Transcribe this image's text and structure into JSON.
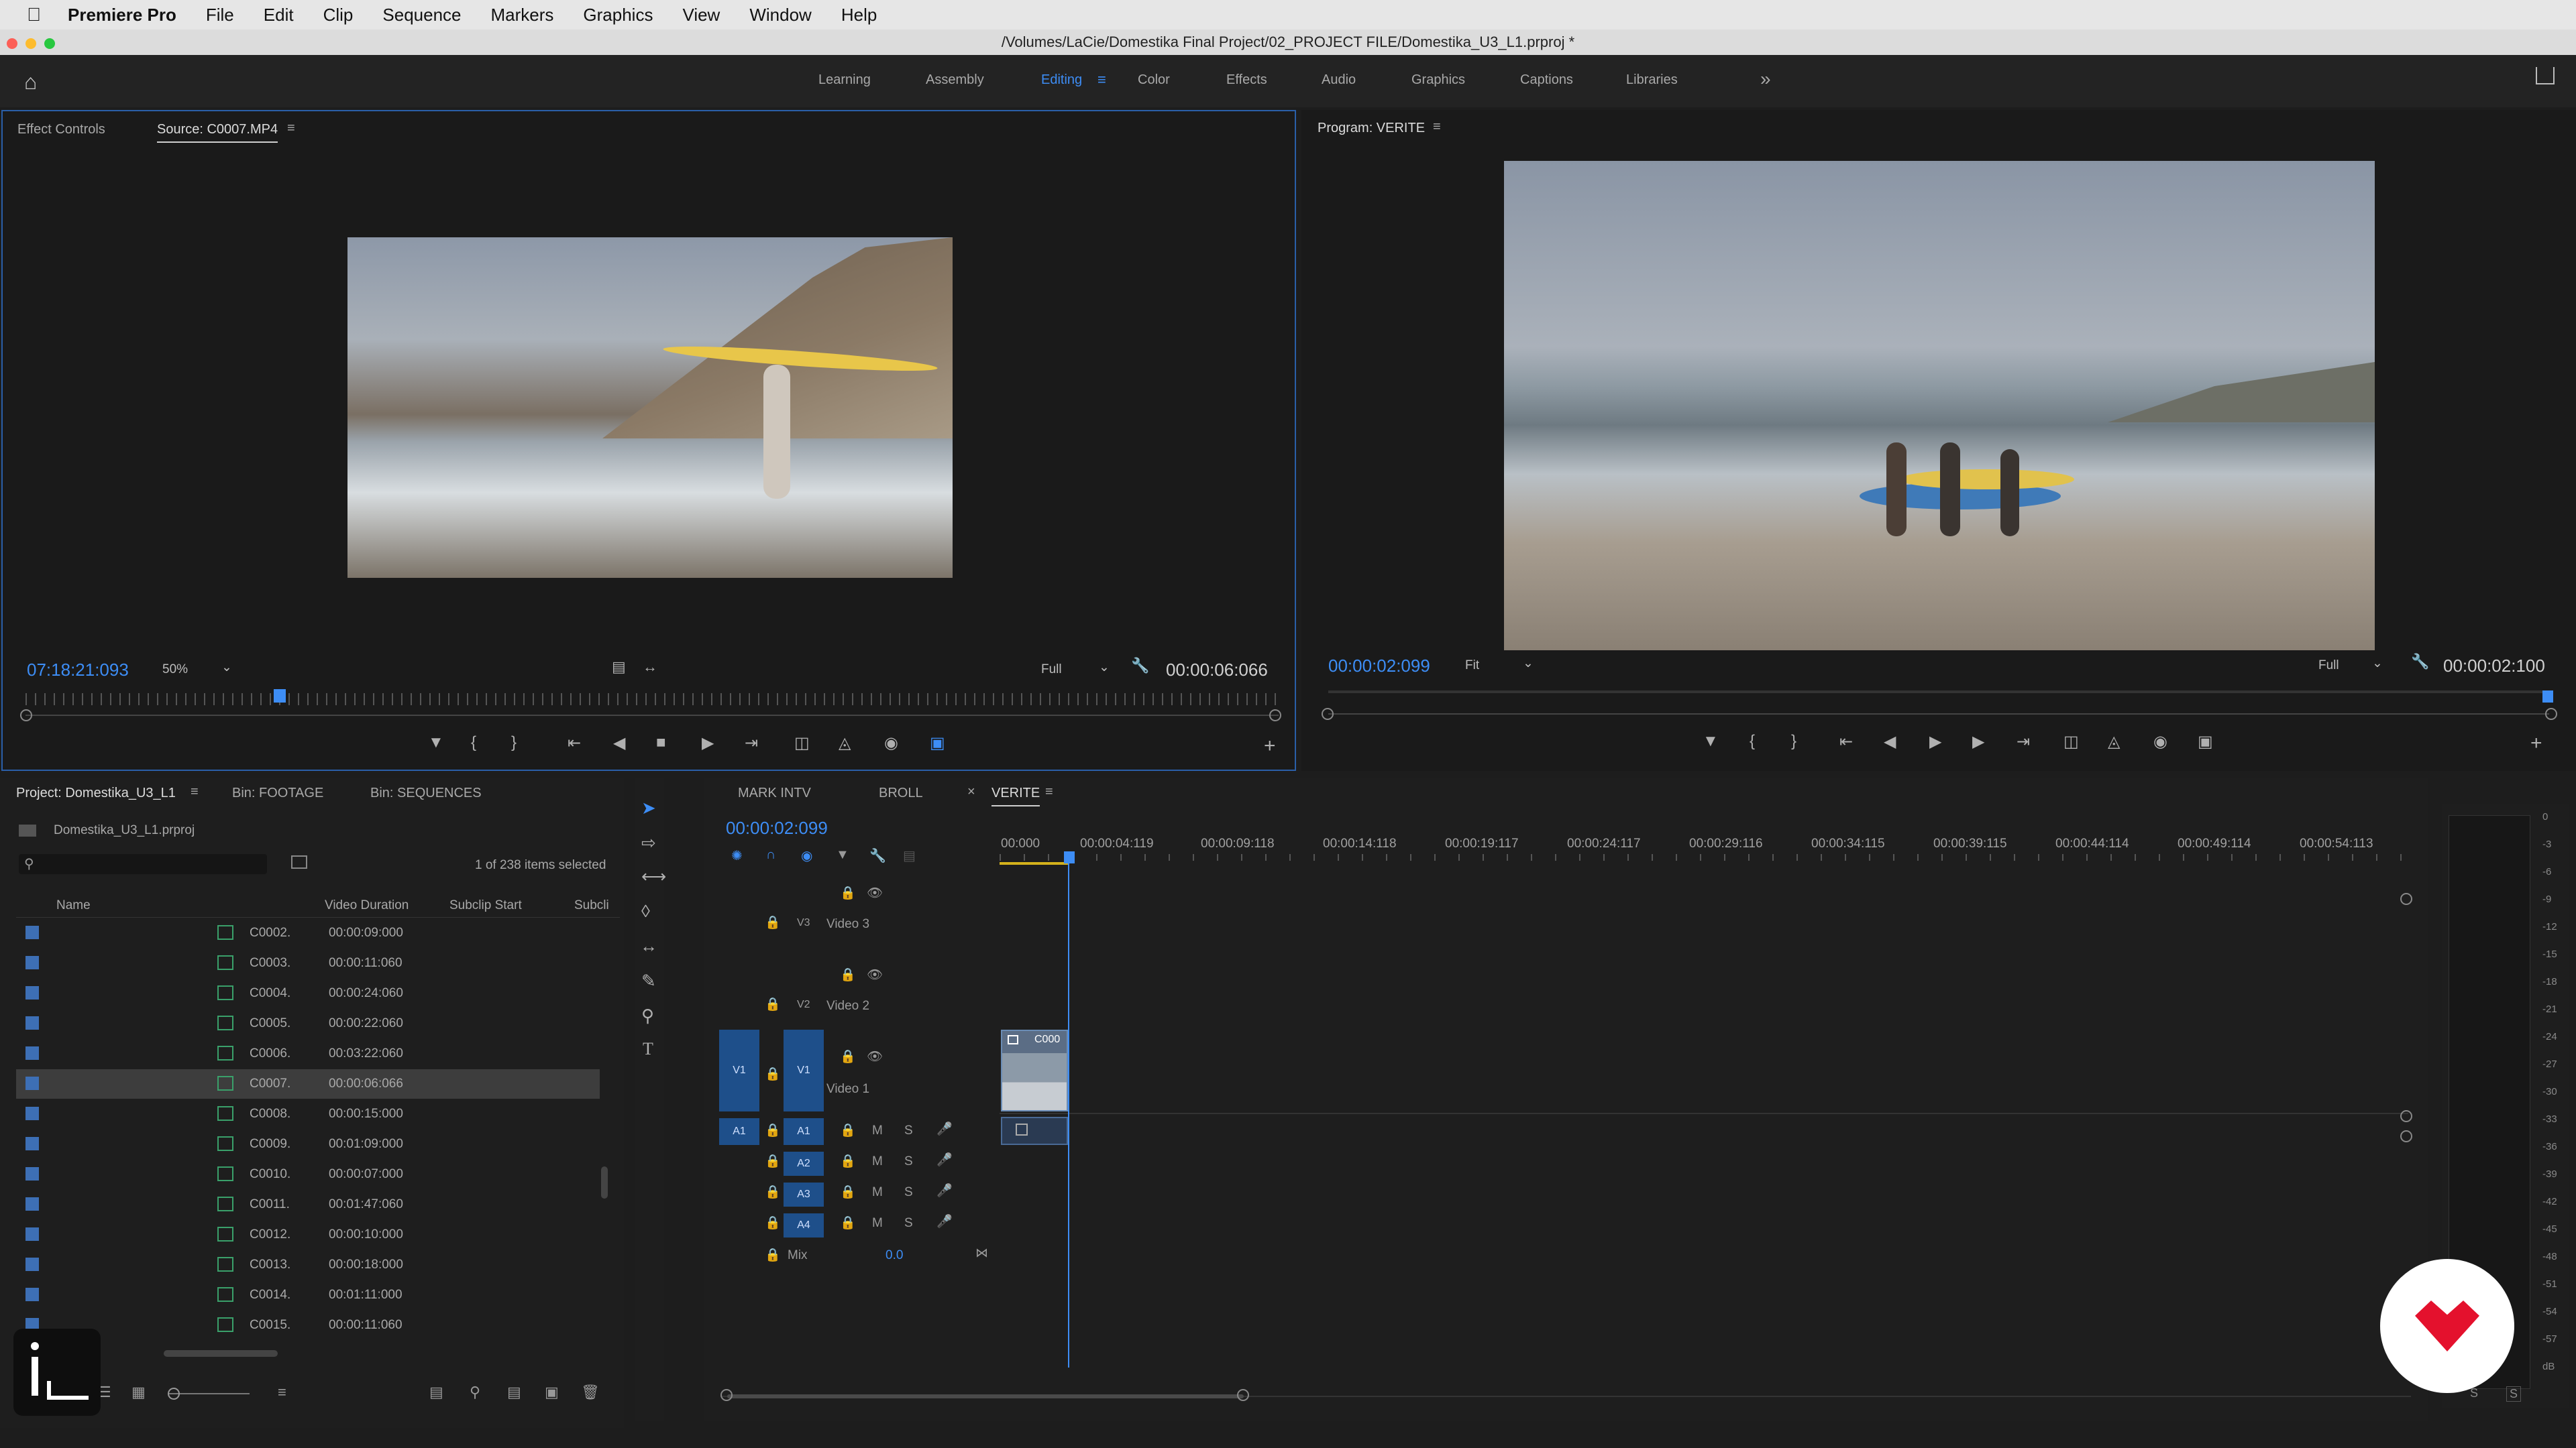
{
  "menubar": {
    "app": "Premiere Pro",
    "items": [
      "File",
      "Edit",
      "Clip",
      "Sequence",
      "Markers",
      "Graphics",
      "View",
      "Window",
      "Help"
    ]
  },
  "title": "/Volumes/LaCie/Domestika Final Project/02_PROJECT FILE/Domestika_U3_L1.prproj *",
  "workspaces": [
    {
      "label": "Learning"
    },
    {
      "label": "Assembly"
    },
    {
      "label": "Editing"
    },
    {
      "label": "Color"
    },
    {
      "label": "Effects"
    },
    {
      "label": "Audio"
    },
    {
      "label": "Graphics"
    },
    {
      "label": "Captions"
    },
    {
      "label": "Libraries"
    }
  ],
  "workspace_more": "»",
  "source": {
    "tab_effect_controls": "Effect Controls",
    "tab_source": "Source: C0007.MP4",
    "timecode": "07:18:21:093",
    "zoom": "50%",
    "quality": "Full",
    "duration": "00:00:06:066"
  },
  "program": {
    "tab": "Program: VERITE",
    "timecode": "00:00:02:099",
    "zoom": "Fit",
    "quality": "Full",
    "duration": "00:00:02:100"
  },
  "project": {
    "tab": "Project: Domestika_U3_L1",
    "bin_footage": "Bin: FOOTAGE",
    "bin_sequences": "Bin: SEQUENCES",
    "file": "Domestika_U3_L1.prproj",
    "selection": "1 of 238 items selected",
    "columns": {
      "name": "Name",
      "duration": "Video Duration",
      "subclip_start": "Subclip Start",
      "subclip_end": "Subcli"
    },
    "rows": [
      {
        "name": "C0002.",
        "duration": "00:00:09:000"
      },
      {
        "name": "C0003.",
        "duration": "00:00:11:060"
      },
      {
        "name": "C0004.",
        "duration": "00:00:24:060"
      },
      {
        "name": "C0005.",
        "duration": "00:00:22:060"
      },
      {
        "name": "C0006.",
        "duration": "00:03:22:060"
      },
      {
        "name": "C0007.",
        "duration": "00:00:06:066"
      },
      {
        "name": "C0008.",
        "duration": "00:00:15:000"
      },
      {
        "name": "C0009.",
        "duration": "00:01:09:000"
      },
      {
        "name": "C0010.",
        "duration": "00:00:07:000"
      },
      {
        "name": "C0011.",
        "duration": "00:01:47:060"
      },
      {
        "name": "C0012.",
        "duration": "00:00:10:000"
      },
      {
        "name": "C0013.",
        "duration": "00:00:18:000"
      },
      {
        "name": "C0014.",
        "duration": "00:01:11:000"
      },
      {
        "name": "C0015.",
        "duration": "00:00:11:060"
      }
    ]
  },
  "timeline": {
    "tabs": [
      "MARK INTV",
      "BROLL",
      "VERITE"
    ],
    "close": "×",
    "timecode": "00:00:02:099",
    "ruler": [
      "00:000",
      "00:00:04:119",
      "00:00:09:118",
      "00:00:14:118",
      "00:00:19:117",
      "00:00:24:117",
      "00:00:29:116",
      "00:00:34:115",
      "00:00:39:115",
      "00:00:44:114",
      "00:00:49:114",
      "00:00:54:113"
    ],
    "video_tracks": [
      {
        "id": "V3",
        "name": "Video 3"
      },
      {
        "id": "V2",
        "name": "Video 2"
      },
      {
        "id": "V1",
        "name": "Video 1",
        "src": "V1"
      }
    ],
    "audio_tracks": [
      {
        "id": "A1",
        "src": "A1"
      },
      {
        "id": "A2"
      },
      {
        "id": "A3"
      },
      {
        "id": "A4"
      }
    ],
    "mute": "M",
    "solo": "S",
    "mix_label": "Mix",
    "mix_value": "0.0",
    "clip_label": "C000"
  },
  "meter": {
    "scale": [
      "0",
      "-3",
      "-6",
      "-9",
      "-12",
      "-15",
      "-18",
      "-21",
      "-24",
      "-27",
      "-30",
      "-33",
      "-36",
      "-39",
      "-42",
      "-45",
      "-48",
      "-51",
      "-54",
      "-57",
      "dB"
    ],
    "solo_left": "S",
    "solo_right": "S"
  }
}
